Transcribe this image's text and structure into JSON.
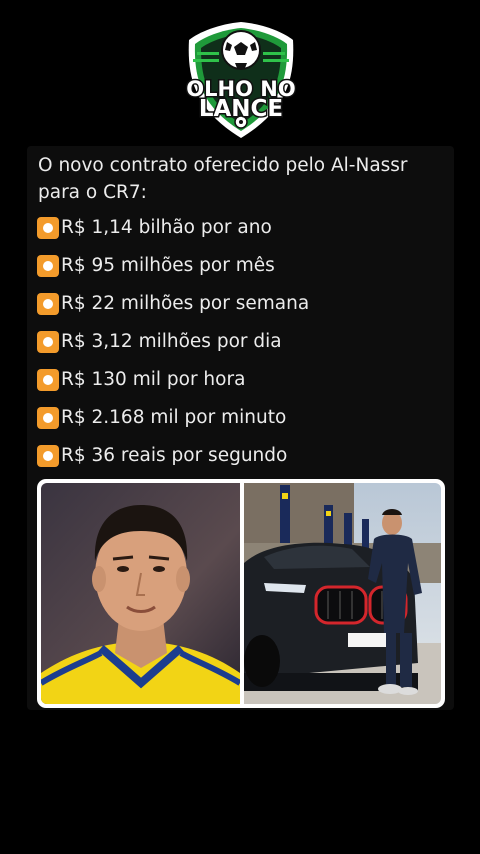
{
  "logo": {
    "line1": "OLHO NO",
    "line2": "LANCE"
  },
  "post": {
    "intro": "O novo contrato oferecido pelo Al-Nassr para o CR7:",
    "items": [
      {
        "text": "R$ 1,14 bilhão por ano"
      },
      {
        "text": "R$ 95 milhões por mês"
      },
      {
        "text": "R$ 22 milhões por semana"
      },
      {
        "text": "R$ 3,12 milhões por dia"
      },
      {
        "text": "R$ 130 mil por hora"
      },
      {
        "text": "R$ 2.168 mil por minuto"
      },
      {
        "text": "R$ 36 reais por segundo"
      }
    ],
    "bullet_icon": "orange-radio-button-icon",
    "bullet_color": "#f39b2b"
  },
  "colors": {
    "background": "#000000",
    "text": "#ececec",
    "logo_green": "#1f9a3a",
    "logo_dark": "#0f2f1a"
  }
}
